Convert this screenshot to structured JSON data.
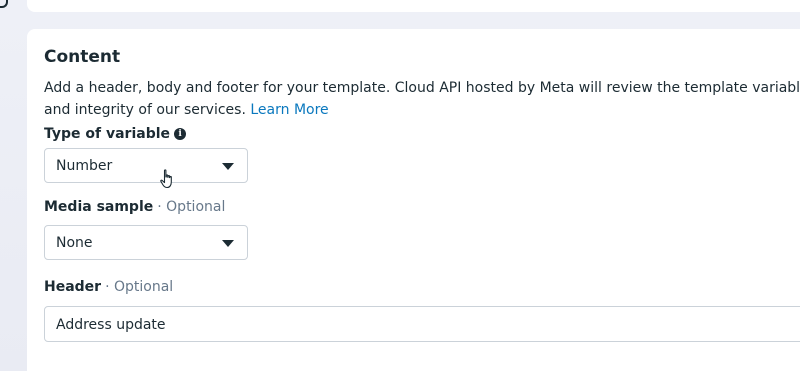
{
  "content": {
    "title": "Content",
    "description_line1": "Add a header, body and footer for your template. Cloud API hosted by Meta will review the template variables and con",
    "description_line2": "and integrity of our services.",
    "learn_more": "Learn More"
  },
  "type_of_variable": {
    "label": "Type of variable",
    "info_glyph": "i",
    "value": "Number"
  },
  "media_sample": {
    "label": "Media sample",
    "optional": "· Optional",
    "value": "None"
  },
  "header": {
    "label": "Header",
    "optional": "· Optional",
    "value": "Address update"
  },
  "icons": {
    "caret": "caret-down-icon",
    "info": "info-icon",
    "cursor": "hand-pointer-icon"
  },
  "colors": {
    "link": "#0a78be",
    "text": "#1c2b33",
    "muted": "#67788a",
    "border": "#cbd2d9",
    "background": "#eceef6"
  }
}
